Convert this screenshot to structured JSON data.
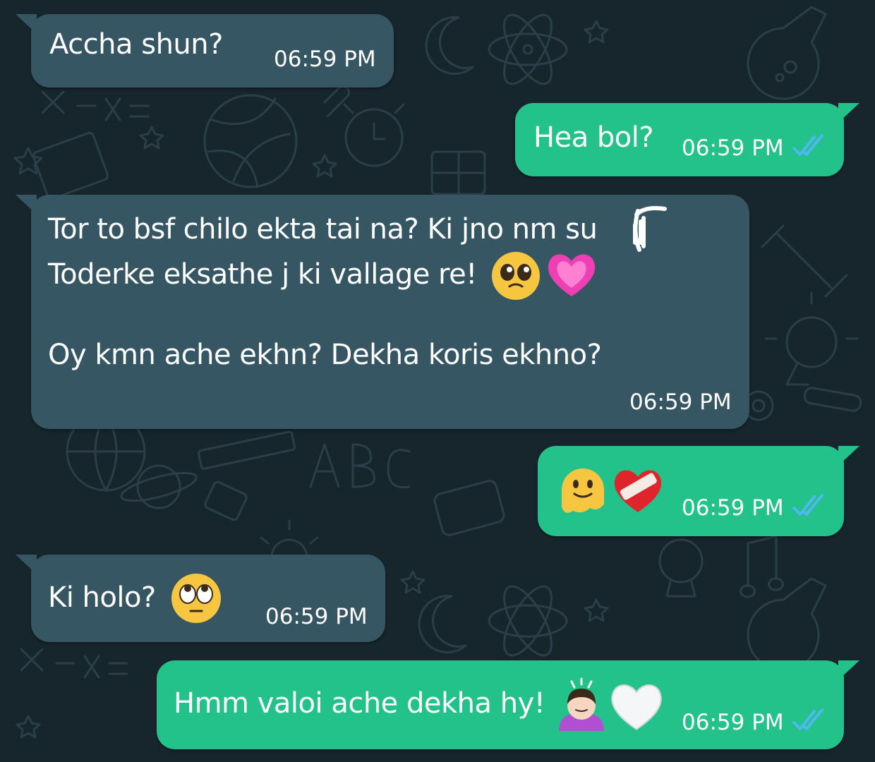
{
  "messages": [
    {
      "direction": "incoming",
      "text": "Accha shun?",
      "time": "06:59 PM"
    },
    {
      "direction": "outgoing",
      "text": "Hea bol?",
      "time": "06:59 PM",
      "status": "read-double-tick-icon"
    },
    {
      "direction": "incoming",
      "lines": [
        "Tor to bsf chilo ekta tai na? Ki jno nm su",
        "Toderke eksathe j ki vallage re!",
        "",
        "Oy kmn ache ekhn? Dekha koris ekhno?"
      ],
      "emojis": [
        "pleading-face-emoji",
        "growing-heart-emoji"
      ],
      "time": "06:59 PM"
    },
    {
      "direction": "outgoing",
      "text": "",
      "emojis": [
        "melting-face-emoji",
        "mending-heart-emoji"
      ],
      "time": "06:59 PM",
      "status": "read-double-tick-icon"
    },
    {
      "direction": "incoming",
      "text": "Ki holo?",
      "emojis": [
        "rolling-eyes-emoji"
      ],
      "time": "06:59 PM"
    },
    {
      "direction": "outgoing",
      "text": "Hmm valoi ache dekha hy!",
      "emojis": [
        "person-bowing-emoji",
        "white-heart-emoji"
      ],
      "time": "06:59 PM",
      "status": "read-double-tick-icon"
    }
  ],
  "colors": {
    "background": "#17252c",
    "incoming_bubble": "#365663",
    "outgoing_bubble": "#23c28a",
    "read_tick": "#4fb8f0",
    "text": "#ffffff"
  }
}
